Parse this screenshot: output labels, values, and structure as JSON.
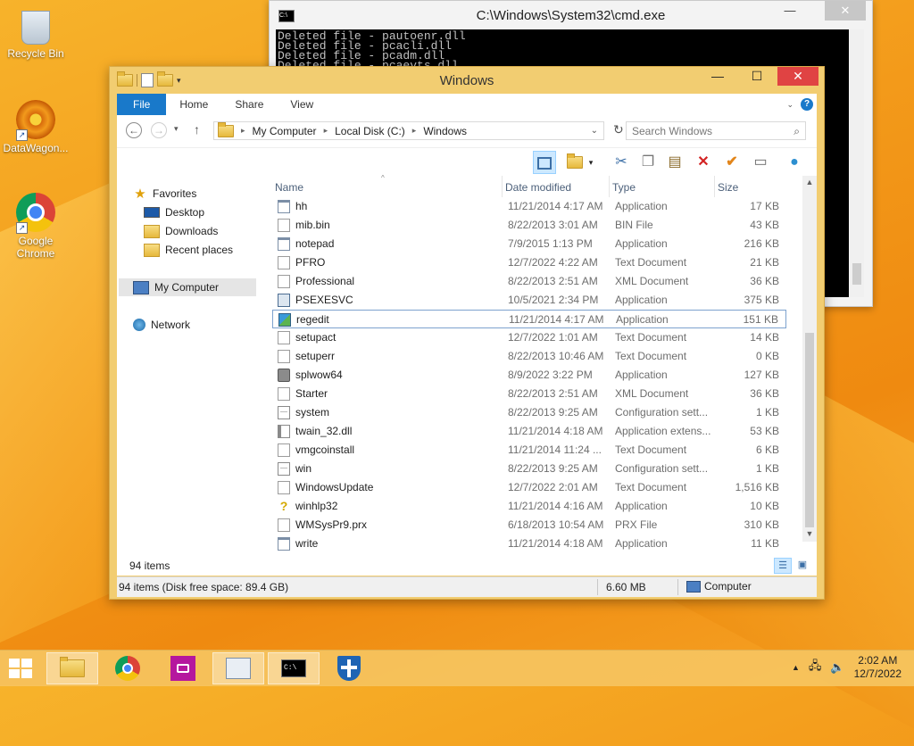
{
  "desktop": {
    "icons": [
      {
        "label": "Recycle Bin"
      },
      {
        "label": "DataWagon..."
      },
      {
        "label": "Google Chrome"
      }
    ]
  },
  "cmd": {
    "title": "C:\\Windows\\System32\\cmd.exe",
    "icon_text": "C:\\",
    "lines": [
      "Deleted file - pautoenr.dll",
      "Deleted file - pcacli.dll",
      "Deleted file - pcadm.dll",
      "Deleted file - pcaevts.dll"
    ],
    "min": "—",
    "max": "☐",
    "close": "✕"
  },
  "explorer": {
    "title": "Windows",
    "min": "—",
    "max": "☐",
    "close": "✕",
    "tabs": [
      "File",
      "Home",
      "Share",
      "View"
    ],
    "address": [
      "My Computer",
      "Local Disk (C:)",
      "Windows"
    ],
    "search_placeholder": "Search Windows",
    "nav": {
      "favorites": "Favorites",
      "desktop": "Desktop",
      "downloads": "Downloads",
      "recent": "Recent places",
      "computer": "My Computer",
      "network": "Network"
    },
    "columns": {
      "name": "Name",
      "date": "Date modified",
      "type": "Type",
      "size": "Size"
    },
    "files": [
      {
        "name": "hh",
        "date": "11/21/2014 4:17 AM",
        "type": "Application",
        "size": "17 KB",
        "icon": "app"
      },
      {
        "name": "mib.bin",
        "date": "8/22/2013 3:01 AM",
        "type": "BIN File",
        "size": "43 KB",
        "icon": "doc"
      },
      {
        "name": "notepad",
        "date": "7/9/2015 1:13 PM",
        "type": "Application",
        "size": "216 KB",
        "icon": "app"
      },
      {
        "name": "PFRO",
        "date": "12/7/2022 4:22 AM",
        "type": "Text Document",
        "size": "21 KB",
        "icon": "doc"
      },
      {
        "name": "Professional",
        "date": "8/22/2013 2:51 AM",
        "type": "XML Document",
        "size": "36 KB",
        "icon": "doc"
      },
      {
        "name": "PSEXESVC",
        "date": "10/5/2021 2:34 PM",
        "type": "Application",
        "size": "375 KB",
        "icon": "ps"
      },
      {
        "name": "regedit",
        "date": "11/21/2014 4:17 AM",
        "type": "Application",
        "size": "151 KB",
        "icon": "reg"
      },
      {
        "name": "setupact",
        "date": "12/7/2022 1:01 AM",
        "type": "Text Document",
        "size": "14 KB",
        "icon": "doc"
      },
      {
        "name": "setuperr",
        "date": "8/22/2013 10:46 AM",
        "type": "Text Document",
        "size": "0 KB",
        "icon": "doc"
      },
      {
        "name": "splwow64",
        "date": "8/9/2022 3:22 PM",
        "type": "Application",
        "size": "127 KB",
        "icon": "prn"
      },
      {
        "name": "Starter",
        "date": "8/22/2013 2:51 AM",
        "type": "XML Document",
        "size": "36 KB",
        "icon": "doc"
      },
      {
        "name": "system",
        "date": "8/22/2013 9:25 AM",
        "type": "Configuration sett...",
        "size": "1 KB",
        "icon": "cfg"
      },
      {
        "name": "twain_32.dll",
        "date": "11/21/2014 4:18 AM",
        "type": "Application extens...",
        "size": "53 KB",
        "icon": "dll"
      },
      {
        "name": "vmgcoinstall",
        "date": "11/21/2014 11:24 ...",
        "type": "Text Document",
        "size": "6 KB",
        "icon": "doc"
      },
      {
        "name": "win",
        "date": "8/22/2013 9:25 AM",
        "type": "Configuration sett...",
        "size": "1 KB",
        "icon": "cfg"
      },
      {
        "name": "WindowsUpdate",
        "date": "12/7/2022 2:01 AM",
        "type": "Text Document",
        "size": "1,516 KB",
        "icon": "doc"
      },
      {
        "name": "winhlp32",
        "date": "11/21/2014 4:16 AM",
        "type": "Application",
        "size": "10 KB",
        "icon": "hlp"
      },
      {
        "name": "WMSysPr9.prx",
        "date": "6/18/2013 10:54 AM",
        "type": "PRX File",
        "size": "310 KB",
        "icon": "doc"
      },
      {
        "name": "write",
        "date": "11/21/2014 4:18 AM",
        "type": "Application",
        "size": "11 KB",
        "icon": "app"
      }
    ],
    "selected_file": "regedit",
    "item_count": "94 items",
    "status_text": "94 items (Disk free space: 89.4 GB)",
    "status_size": "6.60 MB",
    "status_location": "Computer"
  },
  "taskbar": {
    "time": "2:02 AM",
    "date": "12/7/2022"
  }
}
